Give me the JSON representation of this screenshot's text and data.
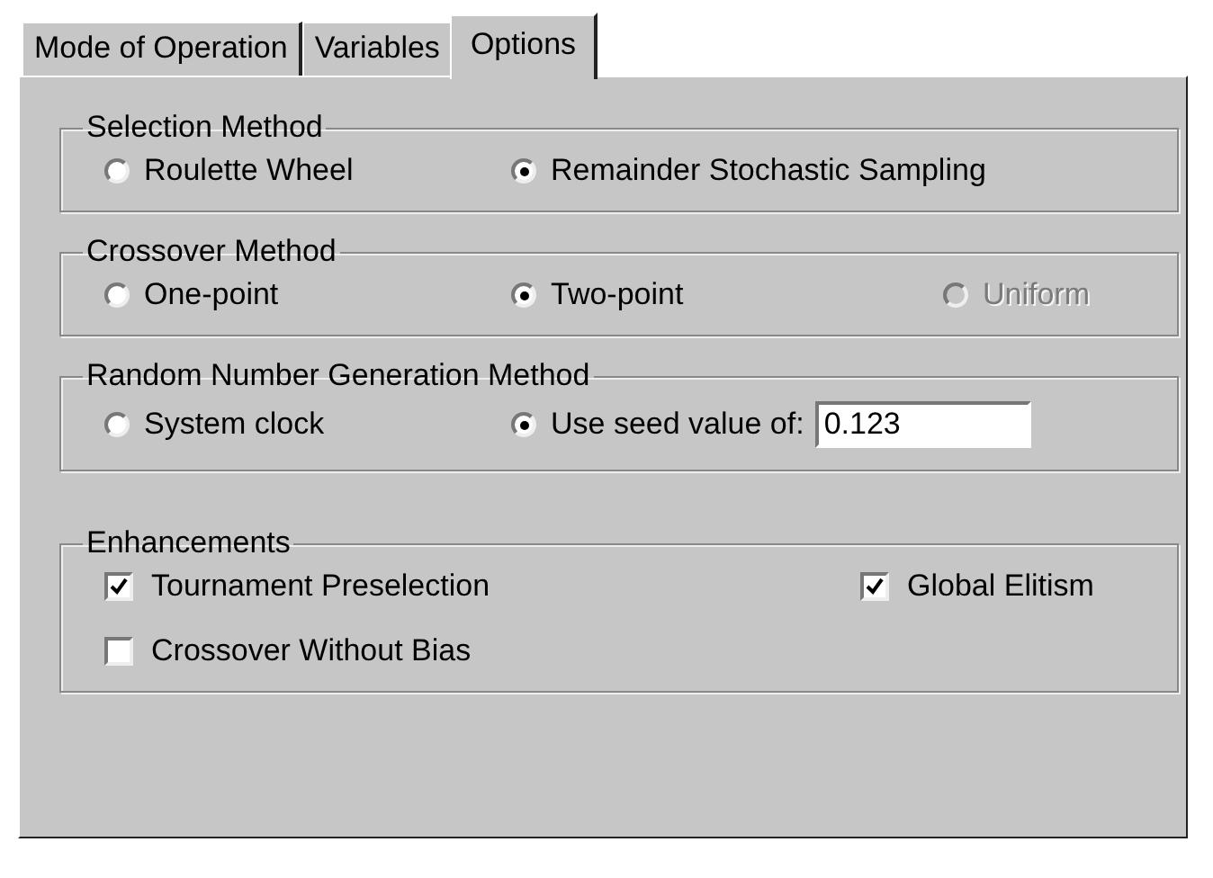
{
  "tabs": [
    {
      "label": "Mode of Operation",
      "selected": false
    },
    {
      "label": "Variables",
      "selected": false
    },
    {
      "label": "Options",
      "selected": true
    }
  ],
  "groups": [
    {
      "title": "Selection Method",
      "kind": "radio",
      "items": [
        {
          "label": "Roulette Wheel",
          "selected": false,
          "disabled": false
        },
        {
          "label": "Remainder Stochastic Sampling",
          "selected": true,
          "disabled": false
        }
      ]
    },
    {
      "title": "Crossover Method",
      "kind": "radio",
      "items": [
        {
          "label": "One-point",
          "selected": false,
          "disabled": false
        },
        {
          "label": "Two-point",
          "selected": true,
          "disabled": false
        },
        {
          "label": "Uniform",
          "selected": false,
          "disabled": true
        }
      ]
    },
    {
      "title": "Random Number Generation Method",
      "kind": "radio",
      "field": {
        "value": "0.123"
      },
      "items": [
        {
          "label": "System clock",
          "selected": false,
          "disabled": false
        },
        {
          "label": "Use seed value of:",
          "selected": true,
          "disabled": false
        }
      ]
    },
    {
      "title": "Enhancements",
      "kind": "checkbox",
      "items": [
        {
          "label": "Tournament Preselection",
          "checked": true
        },
        {
          "label": "Global Elitism",
          "checked": true
        },
        {
          "label": "Crossover Without Bias",
          "checked": false
        }
      ]
    }
  ]
}
